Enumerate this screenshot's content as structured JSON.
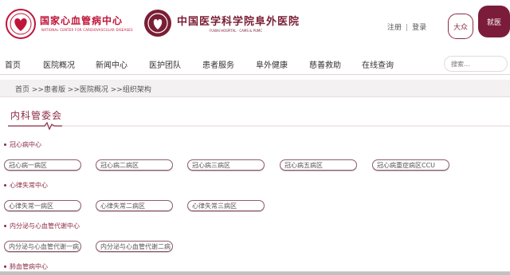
{
  "header": {
    "logo1_name": "国家心血管病中心",
    "logo1_sub": "NATIONAL CENTER FOR CARDIOVASCULAR DISEASES",
    "logo2_name": "中国医学科学院阜外医院",
    "logo2_sub": "FUWAI HOSPITAL · CAMS & PUMC",
    "register": "注册",
    "separator": "|",
    "login": "登录",
    "mode_public": "大众",
    "mode_patient": "就医"
  },
  "nav": {
    "items": [
      "首页",
      "医院概况",
      "新闻中心",
      "医护团队",
      "患者服务",
      "阜外健康",
      "慈善救助",
      "在线查询"
    ],
    "search_placeholder": "搜索..."
  },
  "breadcrumb": {
    "text": "首页 >>患者版 >>医院概况 >>组织架构"
  },
  "section": {
    "title": "内科管委会"
  },
  "groups": [
    {
      "label": "冠心病中心",
      "items": [
        "冠心病一病区",
        "冠心病二病区",
        "冠心病三病区",
        "冠心病五病区",
        "冠心病重症病区CCU"
      ]
    },
    {
      "label": "心律失常中心",
      "items": [
        "心律失常一病区",
        "心律失常二病区",
        "心律失常三病区"
      ]
    },
    {
      "label": "内分泌与心血管代谢中心",
      "items": [
        "内分泌与心血管代谢一病",
        "内分泌与心血管代谢二病"
      ]
    },
    {
      "label": "肺血管病中心",
      "items": []
    }
  ],
  "colors": {
    "brand": "#8c2b45",
    "brand_dark": "#7b1d3a",
    "logo_red": "#c0153a"
  }
}
